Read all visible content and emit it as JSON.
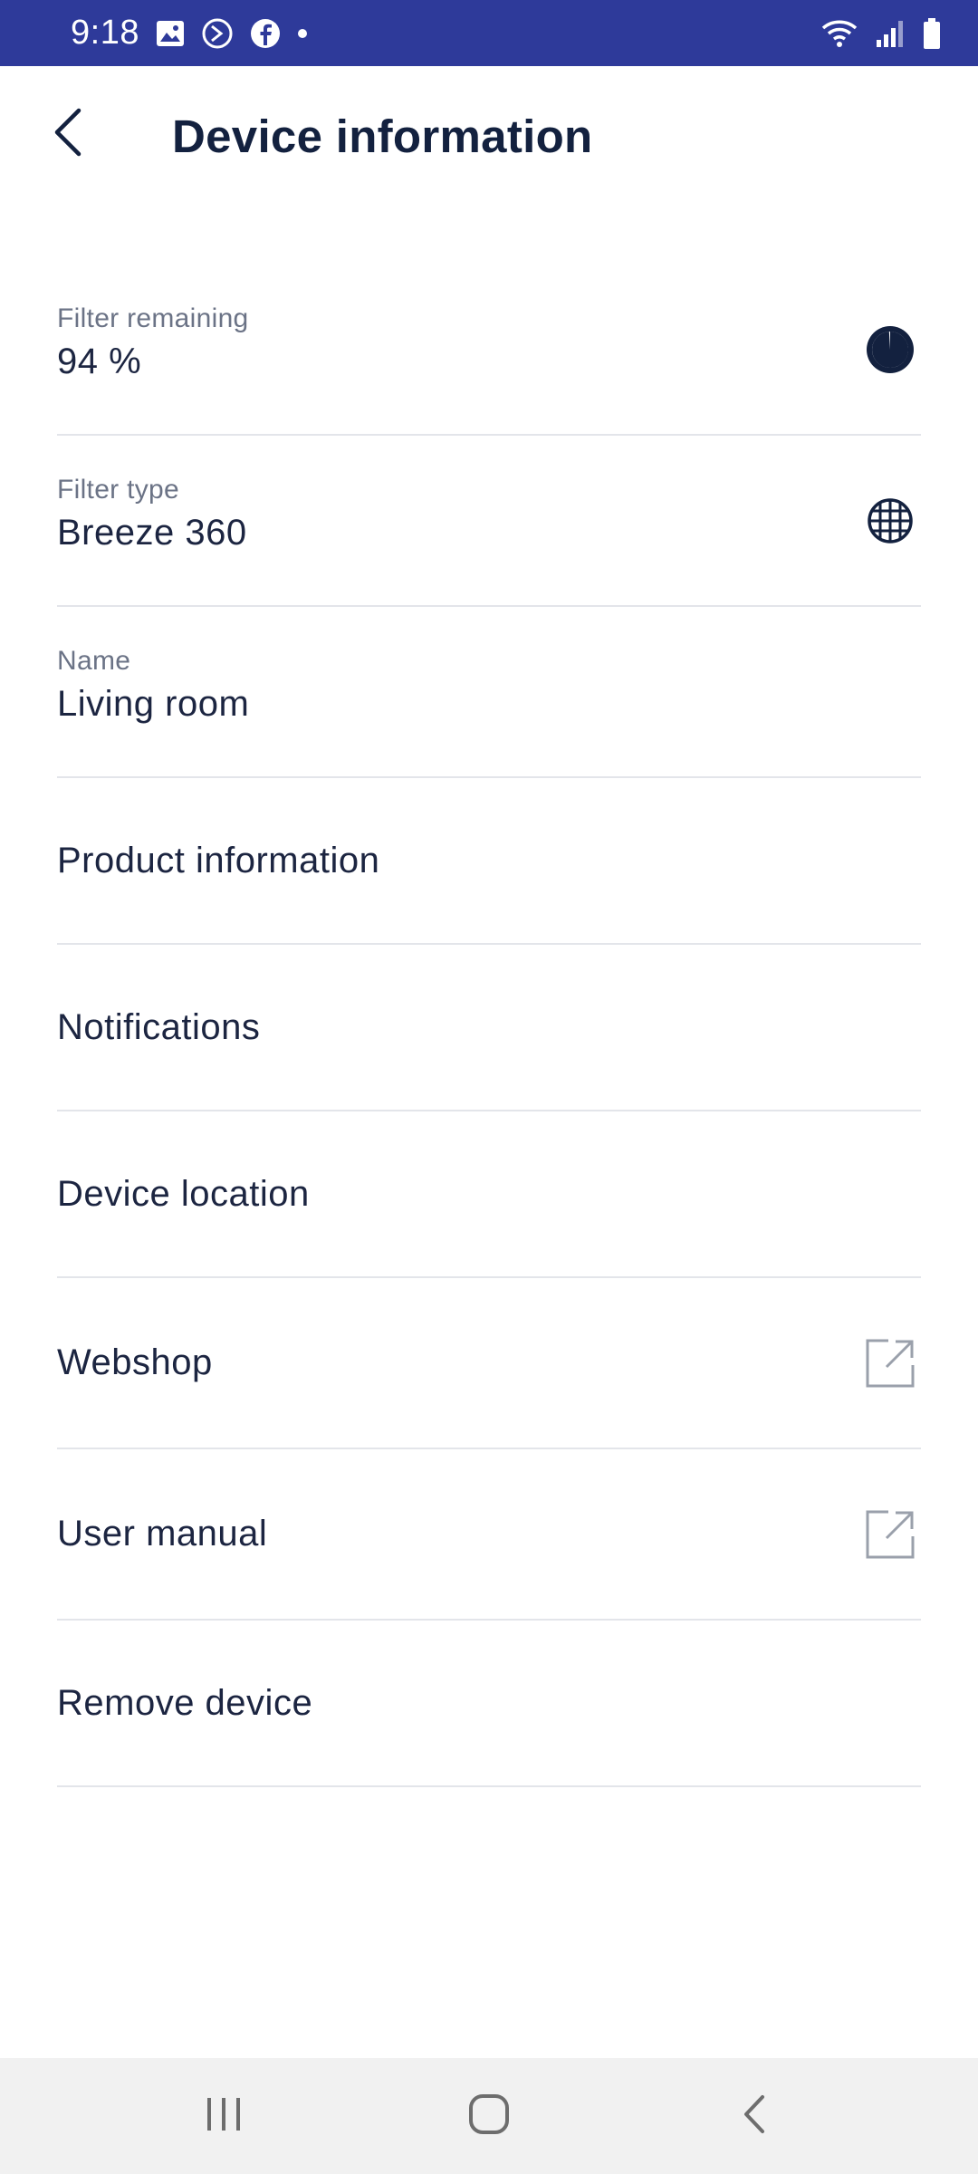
{
  "status_bar": {
    "time": "9:18",
    "background": "#2e3a9a",
    "left_icons": [
      "image-icon",
      "sync-icon",
      "facebook-icon",
      "dot-icon"
    ],
    "right_icons": [
      "wifi-icon",
      "signal-icon",
      "battery-icon"
    ]
  },
  "header": {
    "title": "Device information",
    "back_icon": "chevron-left-icon"
  },
  "rows": {
    "filter_remaining": {
      "label": "Filter remaining",
      "value": "94 %",
      "icon": "timer-icon"
    },
    "filter_type": {
      "label": "Filter type",
      "value": "Breeze 360",
      "icon": "globe-grid-icon"
    },
    "name": {
      "label": "Name",
      "value": "Living room"
    },
    "product_information": {
      "title": "Product information"
    },
    "notifications": {
      "title": "Notifications"
    },
    "device_location": {
      "title": "Device location"
    },
    "webshop": {
      "title": "Webshop",
      "icon": "external-link-icon"
    },
    "user_manual": {
      "title": "User manual",
      "icon": "external-link-icon"
    },
    "remove_device": {
      "title": "Remove device"
    }
  },
  "nav_bar": {
    "buttons": [
      "recent-apps-icon",
      "home-icon",
      "back-icon"
    ]
  },
  "colors": {
    "text_primary": "#1c2541",
    "text_secondary": "#6b7386",
    "divider": "#e3e5ea",
    "nav_background": "#f1f1f1"
  }
}
